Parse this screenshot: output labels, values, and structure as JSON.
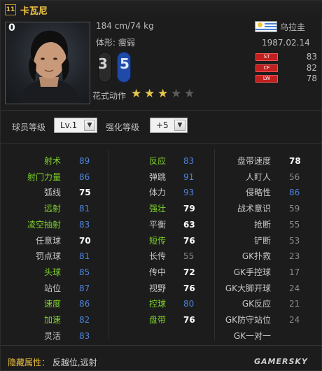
{
  "header": {
    "season_badge": "11",
    "player_name": "卡瓦尼"
  },
  "photo": {
    "overall": "0"
  },
  "info": {
    "height_weight": "184 cm/74 kg",
    "body_type": "体形: 瘦弱",
    "nation": "乌拉圭",
    "birthdate": "1987.02.14"
  },
  "positions": [
    {
      "tag": "ST",
      "value": "83"
    },
    {
      "tag": "CF",
      "value": "82"
    },
    {
      "tag": "LW",
      "value": "78"
    }
  ],
  "feet": {
    "weak": "3",
    "strong": "5"
  },
  "skill_moves": {
    "label": "花式动作",
    "stars": 3,
    "max": 5
  },
  "controls": {
    "level_label": "球员等级",
    "level_value": "Lv.1",
    "upgrade_label": "强化等级",
    "upgrade_value": "+5"
  },
  "stats": {
    "col1": [
      {
        "name": "射术",
        "value": "89",
        "name_color": "green",
        "value_color": "blue"
      },
      {
        "name": "射门力量",
        "value": "86",
        "name_color": "green",
        "value_color": "blue"
      },
      {
        "name": "弧线",
        "value": "75",
        "name_color": "grey",
        "value_color": "white"
      },
      {
        "name": "远射",
        "value": "81",
        "name_color": "green",
        "value_color": "blue"
      },
      {
        "name": "凌空抽射",
        "value": "83",
        "name_color": "green",
        "value_color": "blue"
      },
      {
        "name": "任意球",
        "value": "70",
        "name_color": "grey",
        "value_color": "white"
      },
      {
        "name": "罚点球",
        "value": "81",
        "name_color": "grey",
        "value_color": "blue"
      },
      {
        "name": "头球",
        "value": "85",
        "name_color": "green",
        "value_color": "blue"
      },
      {
        "name": "站位",
        "value": "87",
        "name_color": "grey",
        "value_color": "blue"
      },
      {
        "name": "速度",
        "value": "86",
        "name_color": "green",
        "value_color": "blue"
      },
      {
        "name": "加速",
        "value": "82",
        "name_color": "green",
        "value_color": "blue"
      },
      {
        "name": "灵活",
        "value": "83",
        "name_color": "grey",
        "value_color": "blue"
      }
    ],
    "col2": [
      {
        "name": "反应",
        "value": "83",
        "name_color": "green",
        "value_color": "blue"
      },
      {
        "name": "弹跳",
        "value": "91",
        "name_color": "grey",
        "value_color": "blue"
      },
      {
        "name": "体力",
        "value": "93",
        "name_color": "grey",
        "value_color": "blue"
      },
      {
        "name": "强壮",
        "value": "79",
        "name_color": "green",
        "value_color": "white"
      },
      {
        "name": "平衡",
        "value": "63",
        "name_color": "grey",
        "value_color": "white"
      },
      {
        "name": "短传",
        "value": "76",
        "name_color": "green",
        "value_color": "white"
      },
      {
        "name": "长传",
        "value": "55",
        "name_color": "grey",
        "value_color": "grey"
      },
      {
        "name": "传中",
        "value": "72",
        "name_color": "grey",
        "value_color": "white"
      },
      {
        "name": "视野",
        "value": "76",
        "name_color": "grey",
        "value_color": "white"
      },
      {
        "name": "控球",
        "value": "80",
        "name_color": "green",
        "value_color": "blue"
      },
      {
        "name": "盘带",
        "value": "76",
        "name_color": "green",
        "value_color": "white"
      }
    ],
    "col3": [
      {
        "name": "盘带速度",
        "value": "78",
        "name_color": "grey",
        "value_color": "white"
      },
      {
        "name": "人盯人",
        "value": "56",
        "name_color": "grey",
        "value_color": "grey"
      },
      {
        "name": "侵略性",
        "value": "86",
        "name_color": "grey",
        "value_color": "blue"
      },
      {
        "name": "战术意识",
        "value": "59",
        "name_color": "grey",
        "value_color": "grey"
      },
      {
        "name": "抢断",
        "value": "55",
        "name_color": "grey",
        "value_color": "grey"
      },
      {
        "name": "铲断",
        "value": "53",
        "name_color": "grey",
        "value_color": "grey"
      },
      {
        "name": "GK扑救",
        "value": "23",
        "name_color": "grey",
        "value_color": "grey"
      },
      {
        "name": "GK手控球",
        "value": "17",
        "name_color": "grey",
        "value_color": "grey"
      },
      {
        "name": "GK大脚开球",
        "value": "24",
        "name_color": "grey",
        "value_color": "grey"
      },
      {
        "name": "GK反应",
        "value": "21",
        "name_color": "grey",
        "value_color": "grey"
      },
      {
        "name": "GK防守站位",
        "value": "24",
        "name_color": "grey",
        "value_color": "grey"
      },
      {
        "name": "GK一对一",
        "value": "",
        "name_color": "grey",
        "value_color": "grey"
      }
    ]
  },
  "hidden": {
    "label": "隐藏属性：",
    "value": "反越位,远射"
  },
  "watermark": "GAMERSKY"
}
